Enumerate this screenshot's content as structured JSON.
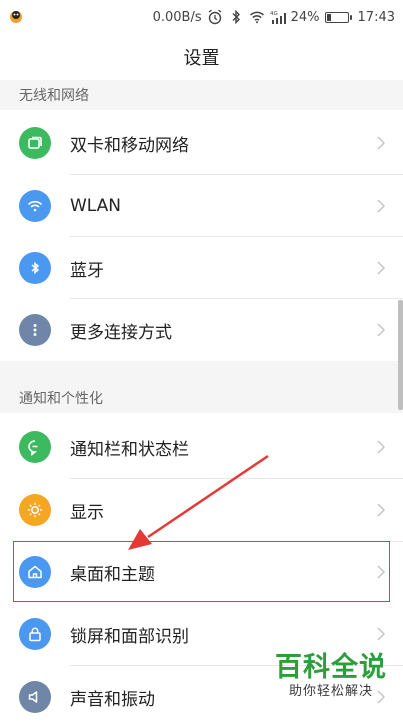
{
  "status_bar": {
    "speed": "0.00B/s",
    "battery_percent": "24%",
    "battery_level": 0.24,
    "time": "17:43",
    "signal_label": "4G"
  },
  "header": {
    "title": "设置"
  },
  "sections": [
    {
      "title": "无线和网络",
      "items": [
        {
          "label": "双卡和移动网络",
          "icon": "sim-card-icon",
          "color": "#3dba5f"
        },
        {
          "label": "WLAN",
          "icon": "wifi-icon",
          "color": "#4b98f0"
        },
        {
          "label": "蓝牙",
          "icon": "bluetooth-icon",
          "color": "#4b98f0"
        },
        {
          "label": "更多连接方式",
          "icon": "more-dots-icon",
          "color": "#6f86a8"
        }
      ]
    },
    {
      "title": "通知和个性化",
      "items": [
        {
          "label": "通知栏和状态栏",
          "icon": "chat-bubble-icon",
          "color": "#3dba5f"
        },
        {
          "label": "显示",
          "icon": "brightness-icon",
          "color": "#f5a623"
        },
        {
          "label": "桌面和主题",
          "icon": "home-icon",
          "color": "#4b98f0"
        },
        {
          "label": "锁屏和面部识别",
          "icon": "lock-icon",
          "color": "#4b98f0"
        },
        {
          "label": "声音和振动",
          "icon": "speaker-icon",
          "color": "#6f86a8"
        }
      ]
    }
  ],
  "annotation": {
    "highlight_color": "#e53935"
  },
  "watermark": {
    "title": "百科全说",
    "subtitle": "助你轻松解决"
  }
}
